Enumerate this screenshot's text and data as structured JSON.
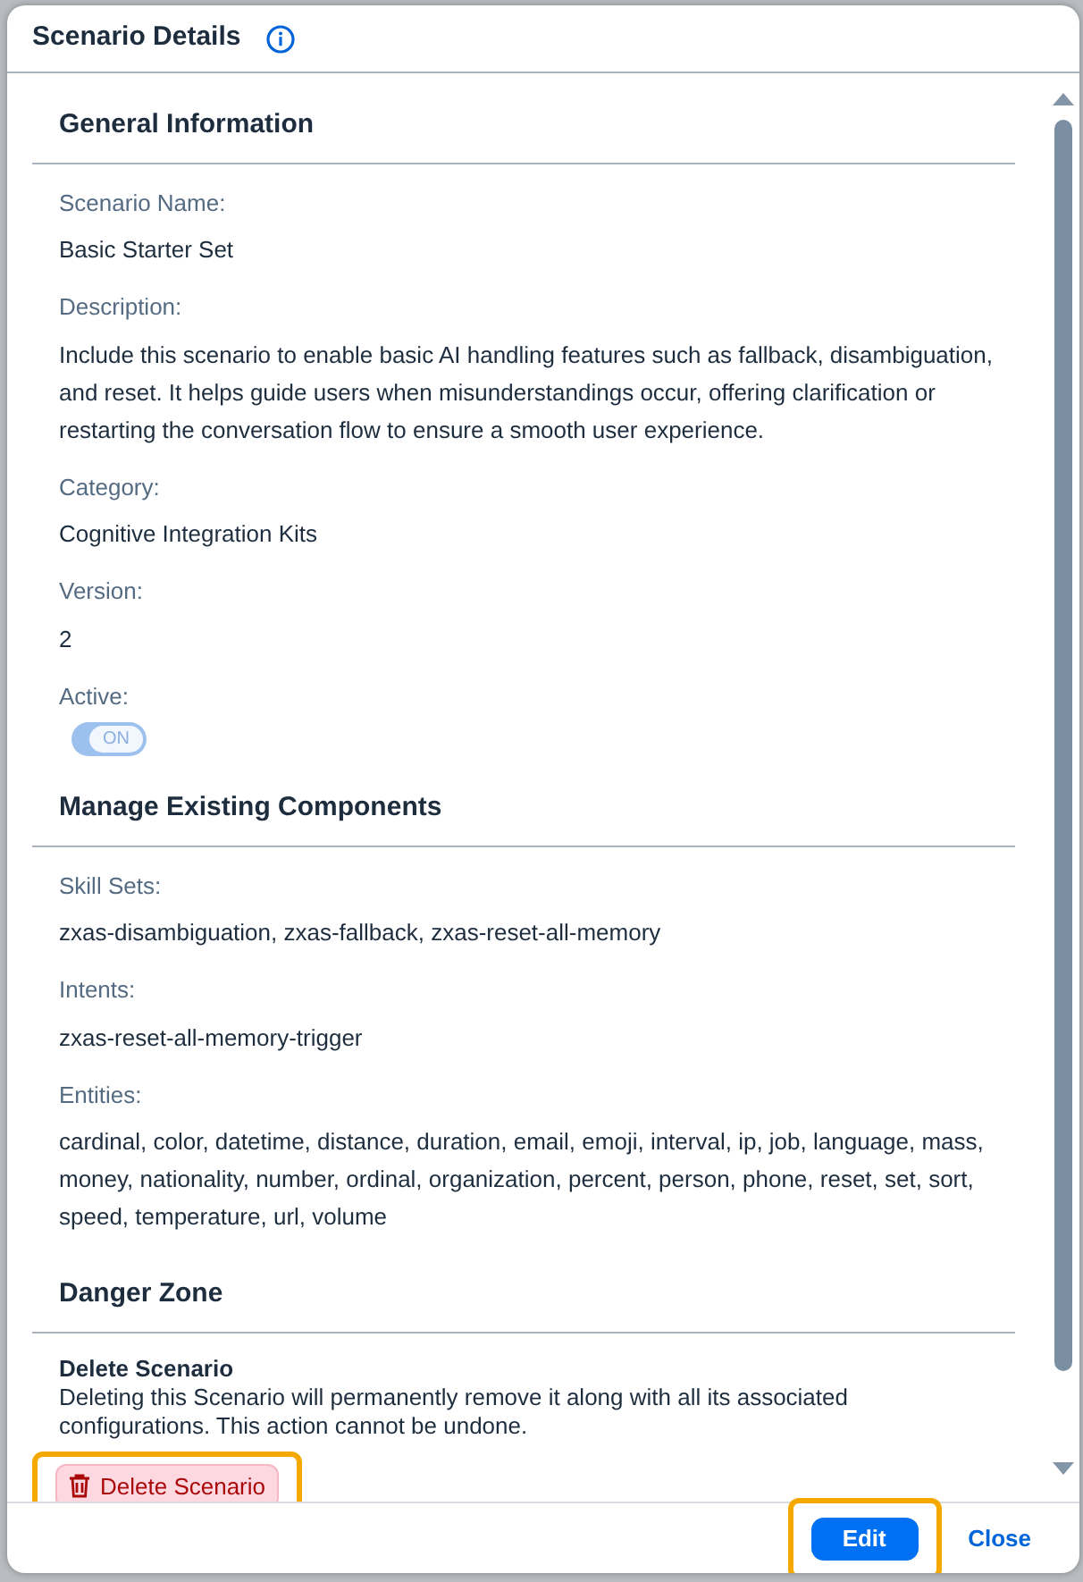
{
  "dialog": {
    "title": "Scenario Details"
  },
  "sections": [
    {
      "heading": "General Information",
      "fields": [
        {
          "kind": "text",
          "label": "Scenario Name:",
          "value": "Basic Starter Set"
        },
        {
          "kind": "text",
          "label": "Description:",
          "value": "Include this scenario to enable basic AI handling features such as fallback, disambiguation, and reset. It helps guide users when misunderstandings occur, offering clarification or restarting the conversation flow to ensure a smooth user experience."
        },
        {
          "kind": "text",
          "label": "Category:",
          "value": "Cognitive Integration Kits"
        },
        {
          "kind": "text",
          "label": "Version:",
          "value": "2"
        },
        {
          "kind": "switch",
          "label": "Active:",
          "value": "ON",
          "on": true,
          "disabled": true
        }
      ]
    },
    {
      "heading": "Manage Existing Components",
      "fields": [
        {
          "kind": "text",
          "label": "Skill Sets:",
          "value": "zxas-disambiguation, zxas-fallback, zxas-reset-all-memory"
        },
        {
          "kind": "text",
          "label": "Intents:",
          "value": "zxas-reset-all-memory-trigger"
        },
        {
          "kind": "text",
          "label": "Entities:",
          "value": "cardinal, color, datetime, distance, duration, email, emoji, interval, ip, job, language, mass, money, nationality, number, ordinal, organization, percent, person, phone, reset, set, sort, speed, temperature, url, volume"
        }
      ]
    }
  ],
  "danger_zone": {
    "heading": "Danger Zone",
    "title": "Delete Scenario",
    "text": "Deleting this Scenario will permanently remove it along with all its associated configurations. This action cannot be undone.",
    "button": "Delete Scenario",
    "highlighted": true
  },
  "footer": {
    "buttons": [
      {
        "label": "Edit",
        "kind": "primary",
        "highlighted": true
      },
      {
        "label": "Close",
        "kind": "link",
        "highlighted": false
      }
    ]
  }
}
